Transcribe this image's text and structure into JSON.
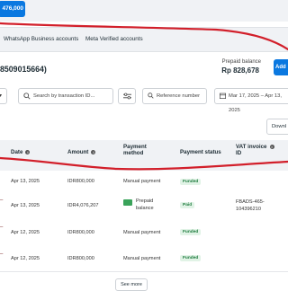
{
  "top": {
    "amount_button": "476,000"
  },
  "tabs": [
    "WhatsApp Business accounts",
    "Meta Verified accounts"
  ],
  "account": {
    "title": "8509015664)"
  },
  "balance": {
    "label": "Prepaid balance",
    "amount": "Rp 828,678",
    "add_label": "Add"
  },
  "filters": {
    "search_placeholder": "Search by transaction ID...",
    "reference_label": "Reference number",
    "date_range": "Mar 17, 2025 – Apr 13, 2025"
  },
  "download_label": "Downl",
  "table": {
    "headers": {
      "date": "Date",
      "amount": "Amount",
      "payment_method": [
        "Payment",
        "method"
      ],
      "payment_status": "Payment status",
      "vat_invoice": [
        "VAT invoice",
        "ID"
      ]
    },
    "rows": [
      {
        "date": "Apr 13, 2025",
        "amount": "IDR800,000",
        "method": "Manual payment",
        "status": "Funded",
        "vat": ""
      },
      {
        "date": "Apr 13, 2025",
        "amount": "IDR4,076,207",
        "method": "Prepaid balance",
        "status": "Paid",
        "vat": "FBADS-465-104396210"
      },
      {
        "date": "Apr 12, 2025",
        "amount": "IDR800,000",
        "method": "Manual payment",
        "status": "Funded",
        "vat": ""
      },
      {
        "date": "Apr 12, 2025",
        "amount": "IDR800,000",
        "method": "Manual payment",
        "status": "Funded",
        "vat": ""
      }
    ]
  },
  "see_more_label": "See more",
  "colors": {
    "primary": "#0a78e0",
    "annotation": "#d21f2a",
    "funded_bg": "#e1f3e6",
    "funded_text": "#1c7a3c"
  },
  "icons": [
    "filter-icon",
    "search-icon",
    "sliders-icon",
    "search-icon",
    "calendar-icon",
    "chevron-down-icon",
    "info-icon",
    "prepaid-card-icon"
  ]
}
